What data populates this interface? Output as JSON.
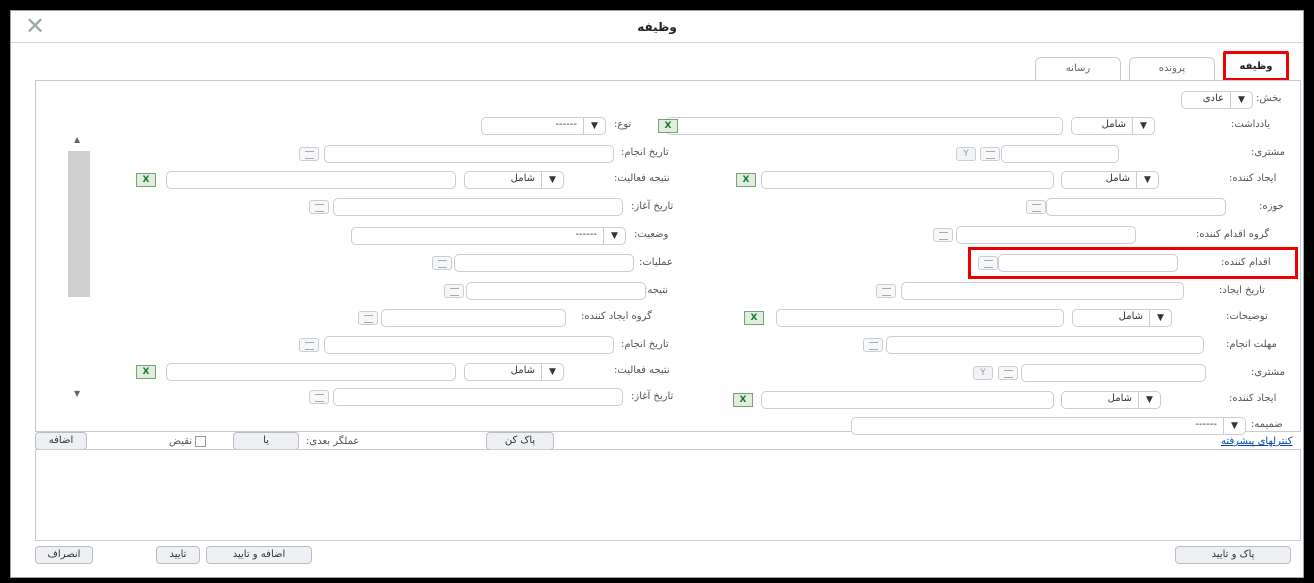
{
  "window": {
    "title": "وظیفه"
  },
  "tabs": [
    {
      "label": "وظیفه",
      "active": true
    },
    {
      "label": "پرونده",
      "active": false
    },
    {
      "label": "رسانه",
      "active": false
    }
  ],
  "form": {
    "section_label": "بخش:",
    "section_value": "عادی",
    "note_label": "یادداشت:",
    "note_match": "شامل",
    "type_label": "نوع:",
    "type_value": "------",
    "customer_label": "مشتری:",
    "done_date_label": "تاریخ انجام:",
    "creator_label": "ایجاد کننده:",
    "creator_match": "شامل",
    "activity_result_label": "نتیجه فعالیت:",
    "activity_result_match": "شامل",
    "domain_label": "حوزه:",
    "start_date_label": "تاریخ آغاز:",
    "action_group_label": "گروه اقدام کننده:",
    "status_label": "وضعیت:",
    "status_value": "------",
    "actor_label": "اقدام کننده:",
    "operations_label": "عملیات:",
    "result_label": "نتیجه:",
    "created_date_label": "تاریخ ایجاد:",
    "creator_group_label": "گروه ایجاد کننده:",
    "descriptions_label": "توضیحات:",
    "descriptions_match": "شامل",
    "deadline_label": "مهلت انجام:",
    "done_date2_label": "تاریخ انجام:",
    "customer2_label": "مشتری:",
    "activity_result2_label": "نتیجه فعالیت:",
    "activity_result2_match": "شامل",
    "creator2_label": "ایجاد کننده:",
    "creator2_match": "شامل",
    "start_date2_label": "تاریخ آغاز:",
    "attachment_label": "ضمیمه:",
    "attachment_value": "------"
  },
  "filterbar": {
    "advanced_link": "کنترلهای پیشرفته",
    "clear_button": "پاک کن",
    "next_operator_label": "عملگر بعدی:",
    "operator_value": "یا",
    "negate_label": "نقیض",
    "add_button": "اضافه"
  },
  "footer": {
    "clear_confirm": "پاک و تایید",
    "add_confirm": "اضافه و تایید",
    "confirm": "تایید",
    "cancel": "انصراف"
  }
}
